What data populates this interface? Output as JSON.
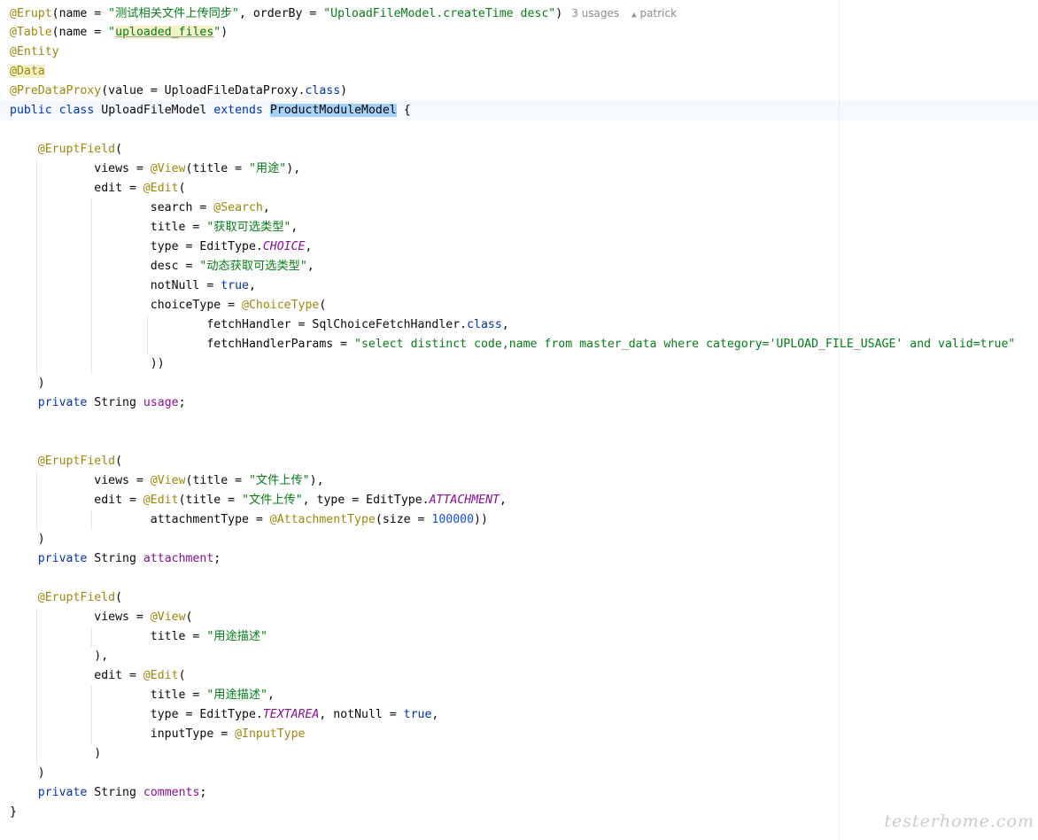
{
  "class_header": {
    "erupt_annotation": "@Erupt",
    "erupt_open": "(name = ",
    "erupt_name": "\"测试相关文件上传同步\"",
    "erupt_orderby": ", orderBy = ",
    "erupt_orderby_value": "\"UploadFileModel.createTime desc\"",
    "erupt_close": ")",
    "usages_hint": "3 usages",
    "author_hint": "patrick",
    "table_annotation": "@Table",
    "table_open": "(name = ",
    "table_name": "uploaded_files",
    "quote": "\"",
    "table_close": ")",
    "entity_annotation": "@Entity",
    "data_annotation": "@Data",
    "predataproxy_annotation": "@PreDataProxy",
    "predataproxy_args": "(value = UploadFileDataProxy.",
    "class_keyword": "class",
    "close_paren": ")",
    "public_keyword": "public",
    "class_kw2": "class",
    "class_name": "UploadFileModel",
    "extends_keyword": "extends",
    "parent_class": "ProductModuleModel",
    "open_brace": "{"
  },
  "usage_field": {
    "eruptfield": "@EruptField",
    "open": "(",
    "views_prefix": "views = ",
    "view_annotation": "@View",
    "title_prefix": "(title = ",
    "view_title": "\"用途\"",
    "close_comma": "),",
    "edit_prefix": "edit = ",
    "edit_annotation": "@Edit",
    "edit_open": "(",
    "search_prefix": "search = ",
    "search_annotation": "@Search",
    "comma": ",",
    "title2_prefix": "title = ",
    "edit_title": "\"获取可选类型\"",
    "type_prefix": "type = EditType.",
    "type_const": "CHOICE",
    "desc_prefix": "desc = ",
    "desc_value": "\"动态获取可选类型\"",
    "notnull_prefix": "notNull = ",
    "true_kw": "true",
    "choicetype_prefix": "choiceType = ",
    "choicetype_annotation": "@ChoiceType",
    "choice_open": "(",
    "fetch_handler_prefix": "fetchHandler = SqlChoiceFetchHandler.",
    "class_kw": "class",
    "fetch_params_prefix": "fetchHandlerParams = ",
    "fetch_params_value": "\"select distinct code,name from master_data where category='UPLOAD_FILE_USAGE' and valid=true\"",
    "double_close": "))",
    "close": ")",
    "private_kw": "private",
    "field_type": " String ",
    "field_name": "usage",
    "semicolon": ";"
  },
  "attachment_field": {
    "eruptfield": "@EruptField",
    "open": "(",
    "views_prefix": "views = ",
    "view_annotation": "@View",
    "title_prefix": "(title = ",
    "view_title": "\"文件上传\"",
    "close_comma": "),",
    "edit_prefix": "edit = ",
    "edit_annotation": "@Edit",
    "edit_title_prefix": "(title = ",
    "edit_title": "\"文件上传\"",
    "type_prefix": ", type = EditType.",
    "type_const": "ATTACHMENT",
    "comma": ",",
    "attachment_type_prefix": "attachmentType = ",
    "attachment_type_annotation": "@AttachmentType",
    "size_prefix": "(size = ",
    "size_value": "100000",
    "size_close": "))",
    "close": ")",
    "private_kw": "private",
    "field_type": " String ",
    "field_name": "attachment",
    "semicolon": ";"
  },
  "comments_field": {
    "eruptfield": "@EruptField",
    "open": "(",
    "views_prefix": "views = ",
    "view_annotation": "@View",
    "view_open": "(",
    "title_prefix": "title = ",
    "view_title": "\"用途描述\"",
    "close_comma": "),",
    "edit_prefix": "edit = ",
    "edit_annotation": "@Edit",
    "edit_open": "(",
    "edit_title": "\"用途描述\"",
    "comma": ",",
    "type_prefix": "type = EditType.",
    "type_const": "TEXTAREA",
    "notnull_prefix": ", notNull = ",
    "true_kw": "true",
    "inputtype_prefix": "inputType = ",
    "inputtype_annotation": "@InputType",
    "close": ")",
    "private_kw": "private",
    "field_type": " String ",
    "field_name": "comments",
    "semicolon": ";"
  },
  "class_close": "}",
  "watermark": "testerhome.com"
}
